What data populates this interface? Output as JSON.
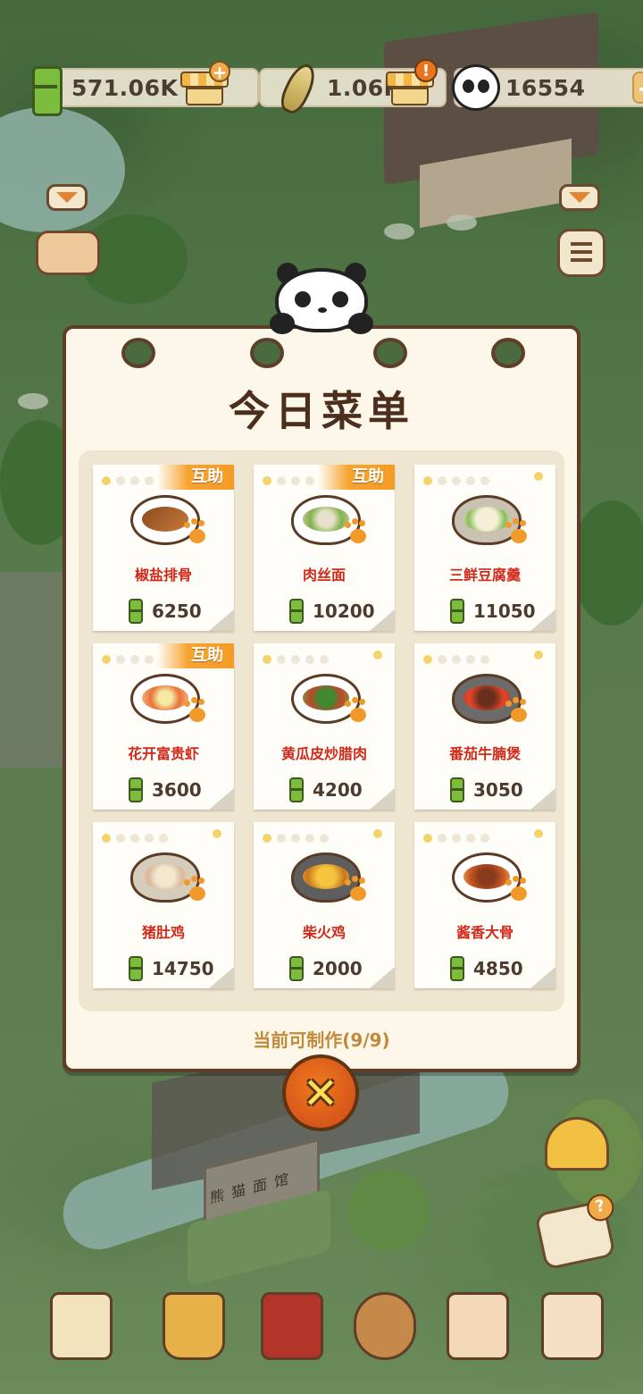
{
  "resources": {
    "bamboo": "571.06K",
    "shoots": "1.06K",
    "panda_coins": "16554"
  },
  "menu": {
    "title": "今日菜单",
    "help_badge": "互助",
    "status": "当前可制作(9/9)",
    "close_symbol": "✕",
    "dishes": [
      {
        "name": "椒盐排骨",
        "price": "6250",
        "help": true
      },
      {
        "name": "肉丝面",
        "price": "10200",
        "help": true
      },
      {
        "name": "三鲜豆腐羹",
        "price": "11050",
        "help": false
      },
      {
        "name": "花开富贵虾",
        "price": "3600",
        "help": true
      },
      {
        "name": "黄瓜皮炒腊肉",
        "price": "4200",
        "help": false
      },
      {
        "name": "番茄牛腩煲",
        "price": "3050",
        "help": false
      },
      {
        "name": "猪肚鸡",
        "price": "14750",
        "help": false
      },
      {
        "name": "柴火鸡",
        "price": "2000",
        "help": false
      },
      {
        "name": "酱香大骨",
        "price": "4850",
        "help": false
      }
    ]
  },
  "scene": {
    "sign_chars": [
      "熊",
      "猫",
      "面",
      "馆"
    ]
  },
  "colors": {
    "accent_orange": "#f6a430",
    "dish_name_red": "#d0291a",
    "frame_brown": "#5e3e28"
  },
  "icons": [
    "bamboo-icon",
    "shop-icon",
    "bamboo-shoot-icon",
    "panda-icon",
    "plus-icon",
    "alert-icon",
    "close-icon",
    "paw-icon",
    "map-icon",
    "paint-bucket-icon",
    "menu-book-icon",
    "hammer-icon",
    "badge-icon",
    "box-icon",
    "bell-icon",
    "help-icon",
    "list-icon"
  ]
}
